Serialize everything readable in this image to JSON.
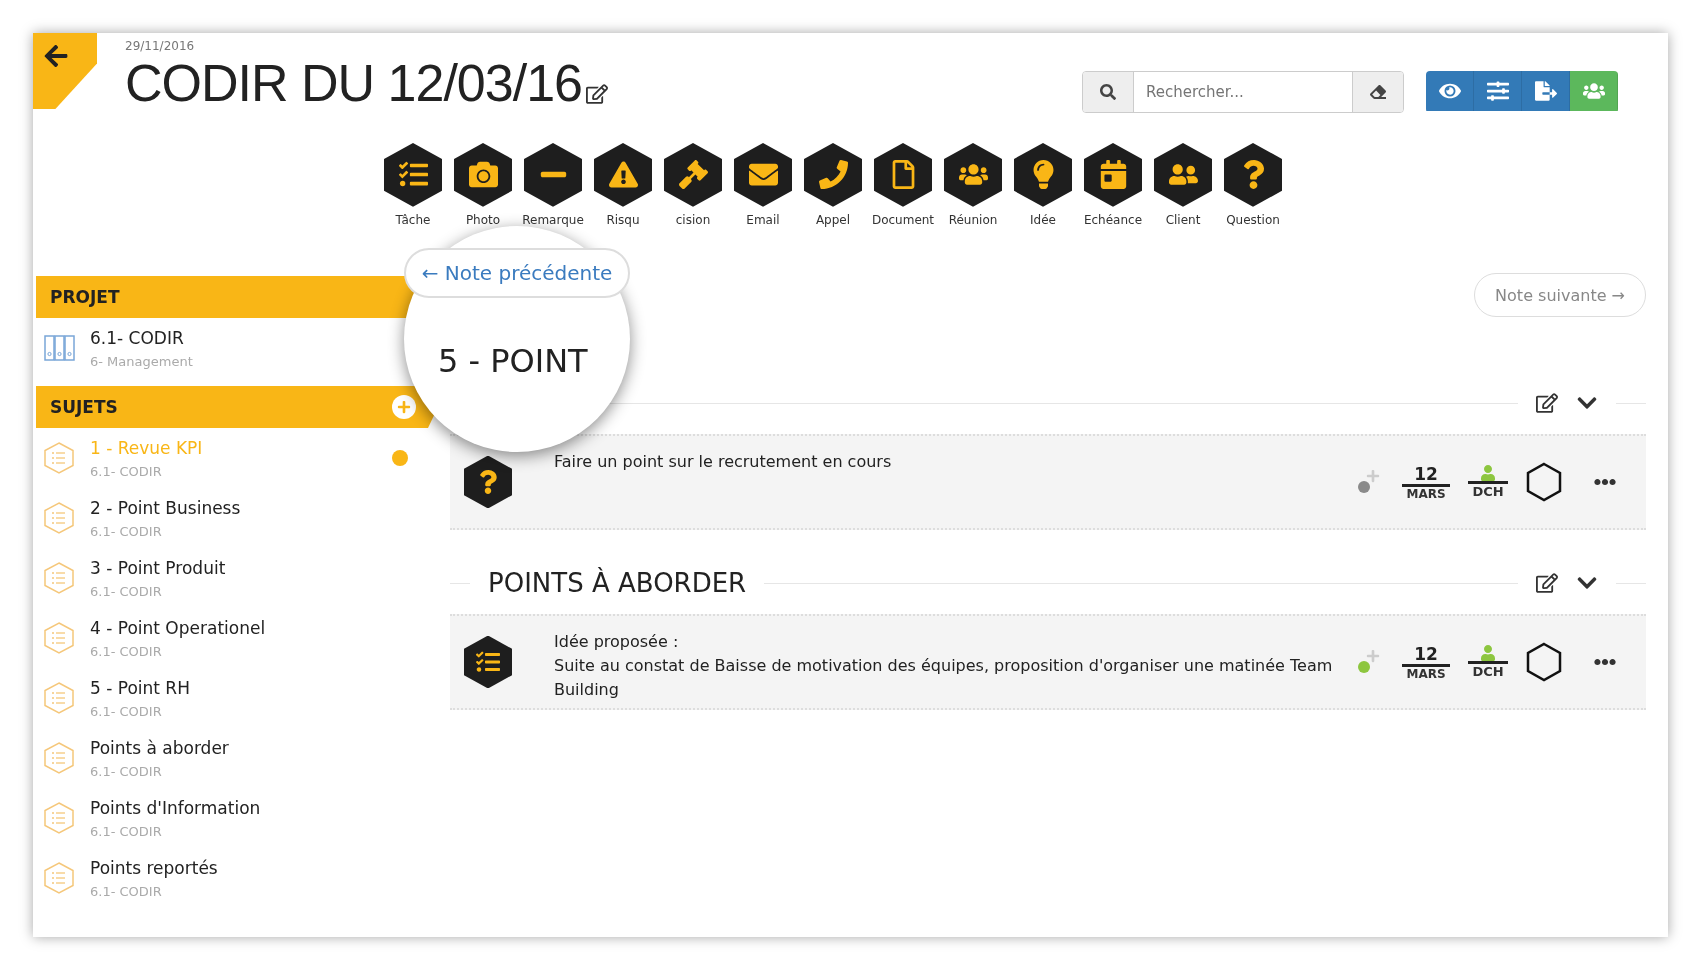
{
  "header": {
    "date": "29/11/2016",
    "title": "CODIR DU 12/03/16"
  },
  "search": {
    "placeholder": "Rechercher..."
  },
  "toolbar": [
    {
      "kind": "task",
      "label": "Tâche"
    },
    {
      "kind": "photo",
      "label": "Photo"
    },
    {
      "kind": "remark",
      "label": "Remarque"
    },
    {
      "kind": "risk",
      "label": "Risqu"
    },
    {
      "kind": "decision",
      "label": "cision"
    },
    {
      "kind": "email",
      "label": "Email"
    },
    {
      "kind": "call",
      "label": "Appel"
    },
    {
      "kind": "document",
      "label": "Document"
    },
    {
      "kind": "meeting",
      "label": "Réunion"
    },
    {
      "kind": "idea",
      "label": "Idée"
    },
    {
      "kind": "deadline",
      "label": "Echéance"
    },
    {
      "kind": "client",
      "label": "Client"
    },
    {
      "kind": "question",
      "label": "Question"
    }
  ],
  "sidebar": {
    "project_heading": "PROJET",
    "project": {
      "name": "6.1- CODIR",
      "parent": "6- Management"
    },
    "subjects_heading": "SUJETS",
    "subjects": [
      {
        "title": "1 - Revue KPI",
        "project": "6.1- CODIR",
        "selected": true
      },
      {
        "title": "2 - Point Business",
        "project": "6.1- CODIR",
        "selected": false
      },
      {
        "title": "3 - Point Produit",
        "project": "6.1- CODIR",
        "selected": false
      },
      {
        "title": "4 - Point Operationel",
        "project": "6.1- CODIR",
        "selected": false
      },
      {
        "title": "5 - Point RH",
        "project": "6.1- CODIR",
        "selected": false
      },
      {
        "title": "Points à aborder",
        "project": "6.1- CODIR",
        "selected": false
      },
      {
        "title": "Points d'Information",
        "project": "6.1- CODIR",
        "selected": false
      },
      {
        "title": "Points reportés",
        "project": "6.1- CODIR",
        "selected": false
      }
    ]
  },
  "nav": {
    "previous": "← Note précédente",
    "next": "Note suivante →"
  },
  "sections": [
    {
      "title": "5 - POINT",
      "notes": [
        {
          "kind": "question",
          "text": "Faire un point sur le recrutement en cours",
          "color": "#8a8a8a",
          "day": "12",
          "month": "MARS",
          "assignee": "DCH"
        }
      ]
    },
    {
      "title": "POINTS À ABORDER",
      "notes": [
        {
          "kind": "task",
          "label": "Idée proposée :",
          "text": "Suite au constat de Baisse de motivation des équipes, proposition d'organiser une matinée Team Building",
          "color": "#8dc63f",
          "day": "12",
          "month": "MARS",
          "assignee": "DCH"
        }
      ]
    }
  ]
}
